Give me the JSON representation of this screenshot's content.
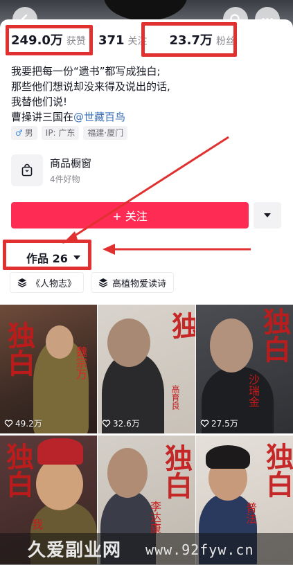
{
  "header": {
    "back_icon": "chevron-left-icon",
    "search_icon": "search-icon",
    "more_icon": "more-icon"
  },
  "stats": {
    "likes": {
      "value": "249.0万",
      "label": "获赞"
    },
    "following": {
      "value": "371",
      "label": "关注"
    },
    "followers": {
      "value": "23.7万",
      "label": "粉丝"
    }
  },
  "bio": {
    "line1": "我要把每一份“遗书”都写成独白;",
    "line2": "那些他们想说却没来得及说出的话,",
    "line3": "我替他们说!",
    "line4_prefix": "曹操讲三国在",
    "line4_mention": "@世藏百鸟"
  },
  "tags": {
    "gender": "男",
    "ip": "IP: 广东",
    "location": "福建·厦门"
  },
  "shop": {
    "title": "商品橱窗",
    "subtitle": "4件好物"
  },
  "follow": {
    "label": "+ 关注"
  },
  "works_tab": {
    "label": "作品 26"
  },
  "collections": [
    {
      "label": "《人物志》"
    },
    {
      "label": "高植物爱读诗"
    }
  ],
  "videos": [
    {
      "likes": "49.2万",
      "overlay": "独白",
      "name": "魏宗万"
    },
    {
      "likes": "32.6万",
      "overlay": "独",
      "name": "高育良"
    },
    {
      "likes": "27.5万",
      "overlay": "独白",
      "name": "沙瑞金"
    },
    {
      "likes": "",
      "overlay": "独白",
      "name": "我"
    },
    {
      "likes": "",
      "overlay": "独白",
      "name": "李达康"
    },
    {
      "likes": "",
      "overlay": "独白",
      "name": "普法"
    }
  ],
  "watermark": {
    "left": "久爱副业网",
    "right": "www.92fyw.cn"
  },
  "colors": {
    "accent": "#fe2c55",
    "annotation_red": "#e0302f",
    "mention_blue": "#3b6fb6",
    "overlay_text": "#c41a1a"
  }
}
